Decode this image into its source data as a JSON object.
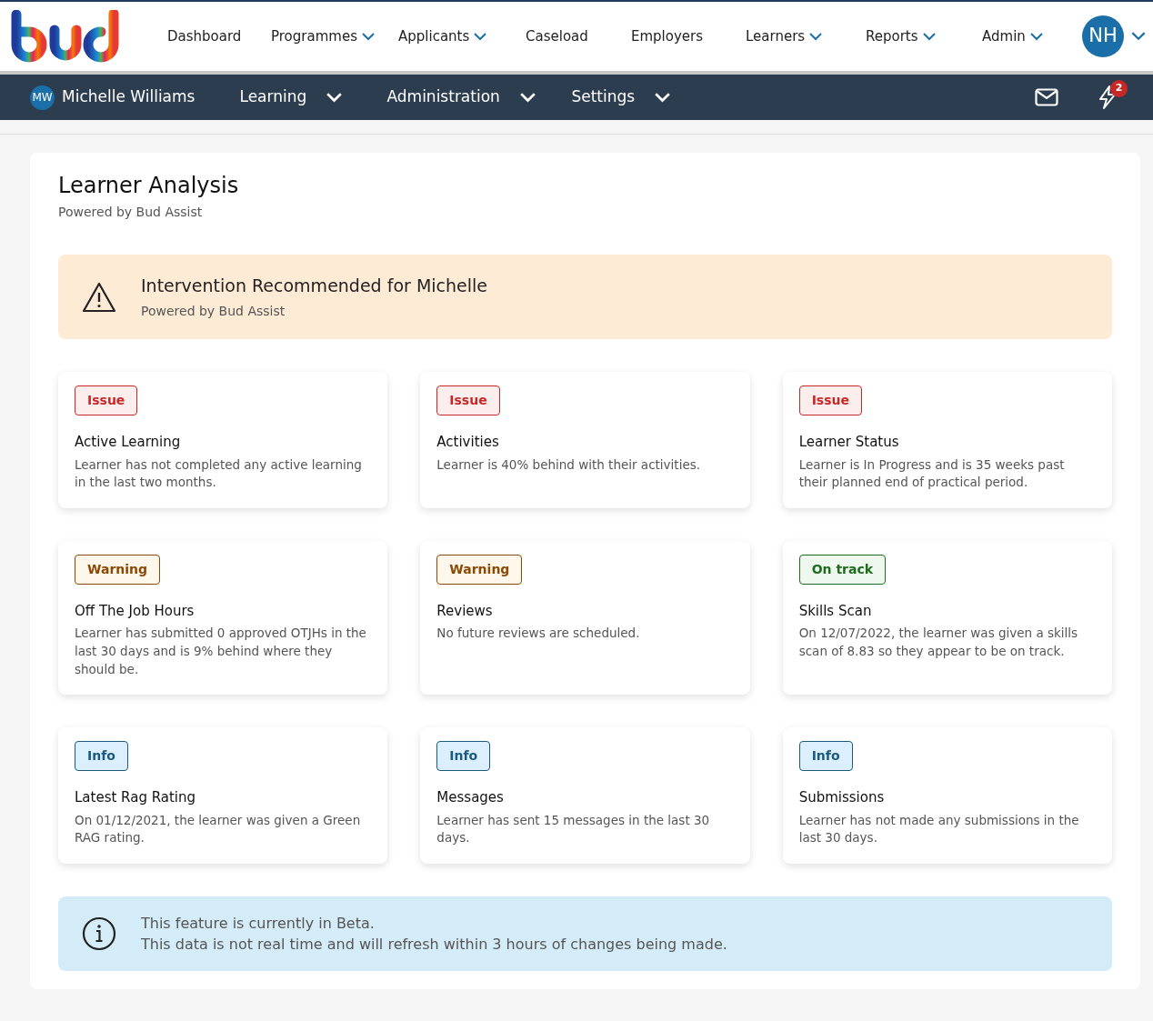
{
  "top_nav": {
    "items": [
      {
        "label": "Dashboard",
        "dropdown": false
      },
      {
        "label": "Programmes",
        "dropdown": true
      },
      {
        "label": "Applicants",
        "dropdown": true
      },
      {
        "label": "Caseload",
        "dropdown": false
      },
      {
        "label": "Employers",
        "dropdown": false
      },
      {
        "label": "Learners",
        "dropdown": true
      },
      {
        "label": "Reports",
        "dropdown": true
      },
      {
        "label": "Admin",
        "dropdown": true
      }
    ],
    "user_initials": "NH"
  },
  "learner_bar": {
    "initials": "MW",
    "name": "Michelle Williams",
    "menus": [
      "Learning",
      "Administration",
      "Settings"
    ],
    "notification_count": "2"
  },
  "page": {
    "title": "Learner Analysis",
    "subtitle": "Powered by Bud Assist"
  },
  "alert": {
    "title": "Intervention Recommended for Michelle",
    "subtitle": "Powered by Bud Assist"
  },
  "findings": [
    {
      "kind": "issue",
      "badge": "Issue",
      "title": "Active Learning",
      "text": "Learner has not completed any active learning in the last two months."
    },
    {
      "kind": "issue",
      "badge": "Issue",
      "title": "Activities",
      "text": "Learner is 40% behind with their activities."
    },
    {
      "kind": "issue",
      "badge": "Issue",
      "title": "Learner Status",
      "text": "Learner is In Progress and is 35 weeks past their planned end of practical period."
    },
    {
      "kind": "warning",
      "badge": "Warning",
      "title": "Off The Job Hours",
      "text": "Learner has submitted 0 approved OTJHs in the last 30 days and is 9% behind where they should be."
    },
    {
      "kind": "warning",
      "badge": "Warning",
      "title": "Reviews",
      "text": "No future reviews are scheduled."
    },
    {
      "kind": "ontrack",
      "badge": "On track",
      "title": "Skills Scan",
      "text": "On 12/07/2022, the learner was given a skills scan of 8.83 so they appear to be on track."
    },
    {
      "kind": "info",
      "badge": "Info",
      "title": "Latest Rag Rating",
      "text": "On 01/12/2021, the learner was given a Green RAG rating."
    },
    {
      "kind": "info",
      "badge": "Info",
      "title": "Messages",
      "text": "Learner has sent 15 messages in the last 30 days."
    },
    {
      "kind": "info",
      "badge": "Info",
      "title": "Submissions",
      "text": "Learner has not made any submissions in the last 30 days."
    }
  ],
  "beta_notice": {
    "lines": [
      "This feature is currently in Beta.",
      "This data is not real time and will refresh within 3 hours of changes being made."
    ]
  }
}
